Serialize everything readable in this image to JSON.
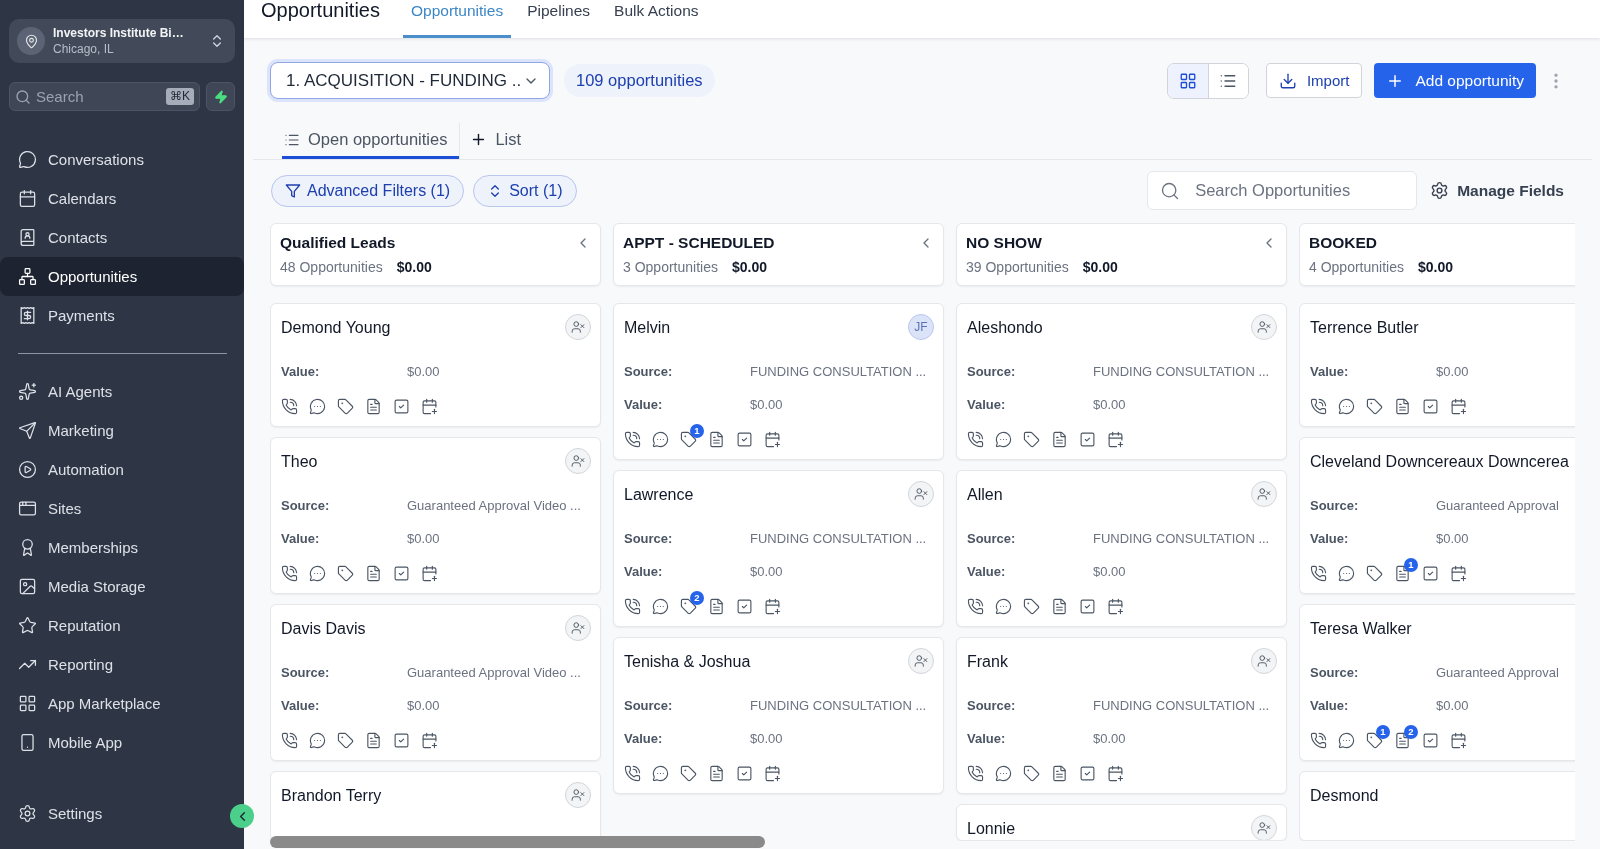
{
  "sidebar": {
    "account": {
      "name": "Investors Institute Bi…",
      "location": "Chicago, IL"
    },
    "search": {
      "placeholder": "Search",
      "shortcut": "⌘K"
    },
    "nav_main": [
      {
        "label": "Conversations",
        "selected": false
      },
      {
        "label": "Calendars",
        "selected": false
      },
      {
        "label": "Contacts",
        "selected": false
      },
      {
        "label": "Opportunities",
        "selected": true
      },
      {
        "label": "Payments",
        "selected": false
      }
    ],
    "nav_tools": [
      {
        "label": "AI Agents",
        "selected": false
      },
      {
        "label": "Marketing",
        "selected": false
      },
      {
        "label": "Automation",
        "selected": false
      },
      {
        "label": "Sites",
        "selected": false
      },
      {
        "label": "Memberships",
        "selected": false
      },
      {
        "label": "Media Storage",
        "selected": false
      },
      {
        "label": "Reputation",
        "selected": false
      },
      {
        "label": "Reporting",
        "selected": false
      },
      {
        "label": "App Marketplace",
        "selected": false
      },
      {
        "label": "Mobile App",
        "selected": false
      }
    ],
    "settings": {
      "label": "Settings",
      "selected": false
    }
  },
  "header": {
    "title": "Opportunities",
    "tabs": [
      {
        "label": "Opportunities",
        "selected": true
      },
      {
        "label": "Pipelines",
        "selected": false
      },
      {
        "label": "Bulk Actions",
        "selected": false
      }
    ]
  },
  "toolbar": {
    "pipeline": "1. ACQUISITION - FUNDING ..",
    "count": "109 opportunities",
    "view_modes": [
      {
        "kind": "board",
        "selected": true
      },
      {
        "kind": "list",
        "selected": false
      }
    ],
    "import_label": "Import",
    "add_label": "Add opportunity"
  },
  "list_tabs": {
    "tabs": [
      {
        "label": "Open opportunities",
        "selected": true
      }
    ],
    "add_label": "List"
  },
  "filter_bar": {
    "filters": [
      {
        "kind": "filter",
        "label": "Advanced Filters (1)"
      },
      {
        "kind": "sort",
        "label": "Sort (1)"
      }
    ],
    "search": {
      "placeholder": "Search Opportunities"
    },
    "manage_fields": "Manage Fields"
  },
  "board": {
    "columns": [
      {
        "title": "Qualified Leads",
        "count": "48 Opportunities",
        "total": "$0.00",
        "cut_off": false,
        "cards": [
          {
            "name": "Demond Young",
            "assignee": {
              "kind": "unassigned"
            },
            "fields": [
              {
                "label": "Value:",
                "value": "$0.00"
              }
            ]
          },
          {
            "name": "Theo",
            "assignee": {
              "kind": "unassigned"
            },
            "fields": [
              {
                "label": "Source:",
                "value": "Guaranteed Approval Video ..."
              },
              {
                "label": "Value:",
                "value": "$0.00"
              }
            ]
          },
          {
            "name": "Davis Davis",
            "assignee": {
              "kind": "unassigned"
            },
            "fields": [
              {
                "label": "Source:",
                "value": "Guaranteed Approval Video ..."
              },
              {
                "label": "Value:",
                "value": "$0.00"
              }
            ]
          },
          {
            "name": "Brandon Terry",
            "assignee": {
              "kind": "unassigned"
            }
          }
        ]
      },
      {
        "title": "APPT - SCHEDULED",
        "count": "3 Opportunities",
        "total": "$0.00",
        "cut_off": false,
        "cards": [
          {
            "name": "Melvin",
            "assignee": {
              "kind": "initials",
              "initials": "JF"
            },
            "tag_count": "1",
            "fields": [
              {
                "label": "Source:",
                "value": "FUNDING CONSULTATION ..."
              },
              {
                "label": "Value:",
                "value": "$0.00"
              }
            ]
          },
          {
            "name": "Lawrence",
            "assignee": {
              "kind": "unassigned"
            },
            "tag_count": "2",
            "fields": [
              {
                "label": "Source:",
                "value": "FUNDING CONSULTATION ..."
              },
              {
                "label": "Value:",
                "value": "$0.00"
              }
            ]
          },
          {
            "name": "Tenisha & Joshua",
            "assignee": {
              "kind": "unassigned"
            },
            "fields": [
              {
                "label": "Source:",
                "value": "FUNDING CONSULTATION ..."
              },
              {
                "label": "Value:",
                "value": "$0.00"
              }
            ]
          }
        ]
      },
      {
        "title": "NO SHOW",
        "count": "39 Opportunities",
        "total": "$0.00",
        "cut_off": false,
        "cards": [
          {
            "name": "Aleshondo",
            "assignee": {
              "kind": "unassigned"
            },
            "fields": [
              {
                "label": "Source:",
                "value": "FUNDING CONSULTATION ..."
              },
              {
                "label": "Value:",
                "value": "$0.00"
              }
            ]
          },
          {
            "name": "Allen",
            "assignee": {
              "kind": "unassigned"
            },
            "fields": [
              {
                "label": "Source:",
                "value": "FUNDING CONSULTATION ..."
              },
              {
                "label": "Value:",
                "value": "$0.00"
              }
            ]
          },
          {
            "name": "Frank",
            "assignee": {
              "kind": "unassigned"
            },
            "fields": [
              {
                "label": "Source:",
                "value": "FUNDING CONSULTATION ..."
              },
              {
                "label": "Value:",
                "value": "$0.00"
              }
            ]
          },
          {
            "name": "Lonnie",
            "assignee": {
              "kind": "unassigned"
            }
          }
        ]
      },
      {
        "title": "BOOKED",
        "count": "4 Opportunities",
        "total": "$0.00",
        "cut_off": true,
        "cards": [
          {
            "name": "Terrence Butler",
            "fields": [
              {
                "label": "Value:",
                "value": "$0.00"
              }
            ]
          },
          {
            "name": "Cleveland Downcereaux Downcerea",
            "note_count": "1",
            "fields": [
              {
                "label": "Source:",
                "value": "Guaranteed Approval"
              },
              {
                "label": "Value:",
                "value": "$0.00"
              }
            ]
          },
          {
            "name": "Teresa Walker",
            "tag_count": "1",
            "note_count": "2",
            "fields": [
              {
                "label": "Source:",
                "value": "Guaranteed Approval"
              },
              {
                "label": "Value:",
                "value": "$0.00"
              }
            ]
          },
          {
            "name": "Desmond"
          }
        ]
      }
    ]
  }
}
